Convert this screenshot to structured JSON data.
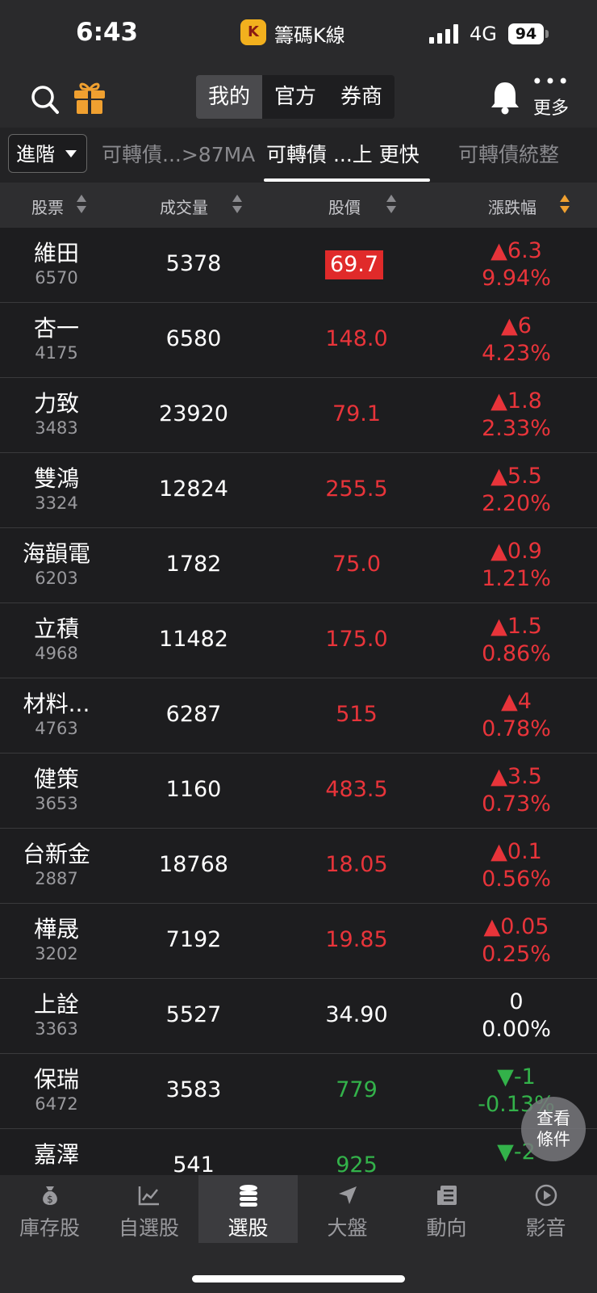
{
  "status": {
    "time": "6:43",
    "app_icon": "K",
    "app_name": "籌碼K線",
    "network": "4G",
    "battery": "94"
  },
  "header": {
    "segments": [
      "我的",
      "官方",
      "券商"
    ],
    "more_label": "更多"
  },
  "subtabs": {
    "advanced": "進階",
    "tabs": [
      "可轉債...>87MA",
      "可轉債 ...上 更快",
      "可轉債統整"
    ]
  },
  "table": {
    "headers": {
      "stock": "股票",
      "volume": "成交量",
      "price": "股價",
      "change": "漲跌幅"
    },
    "rows": [
      {
        "name": "維田",
        "code": "6570",
        "volume": "5378",
        "price": "69.7",
        "change": "▲6.3",
        "pct": "9.94%",
        "dir": "up",
        "limit_up": true
      },
      {
        "name": "杏一",
        "code": "4175",
        "volume": "6580",
        "price": "148.0",
        "change": "▲6",
        "pct": "4.23%",
        "dir": "up"
      },
      {
        "name": "力致",
        "code": "3483",
        "volume": "23920",
        "price": "79.1",
        "change": "▲1.8",
        "pct": "2.33%",
        "dir": "up"
      },
      {
        "name": "雙鴻",
        "code": "3324",
        "volume": "12824",
        "price": "255.5",
        "change": "▲5.5",
        "pct": "2.20%",
        "dir": "up"
      },
      {
        "name": "海韻電",
        "code": "6203",
        "volume": "1782",
        "price": "75.0",
        "change": "▲0.9",
        "pct": "1.21%",
        "dir": "up"
      },
      {
        "name": "立積",
        "code": "4968",
        "volume": "11482",
        "price": "175.0",
        "change": "▲1.5",
        "pct": "0.86%",
        "dir": "up"
      },
      {
        "name": "材料...",
        "code": "4763",
        "volume": "6287",
        "price": "515",
        "change": "▲4",
        "pct": "0.78%",
        "dir": "up"
      },
      {
        "name": "健策",
        "code": "3653",
        "volume": "1160",
        "price": "483.5",
        "change": "▲3.5",
        "pct": "0.73%",
        "dir": "up"
      },
      {
        "name": "台新金",
        "code": "2887",
        "volume": "18768",
        "price": "18.05",
        "change": "▲0.1",
        "pct": "0.56%",
        "dir": "up"
      },
      {
        "name": "樺晟",
        "code": "3202",
        "volume": "7192",
        "price": "19.85",
        "change": "▲0.05",
        "pct": "0.25%",
        "dir": "up"
      },
      {
        "name": "上詮",
        "code": "3363",
        "volume": "5527",
        "price": "34.90",
        "change": "0",
        "pct": "0.00%",
        "dir": "flat"
      },
      {
        "name": "保瑞",
        "code": "6472",
        "volume": "3583",
        "price": "779",
        "change": "▼-1",
        "pct": "-0.13%",
        "dir": "down"
      },
      {
        "name": "嘉澤",
        "code": "",
        "volume": "541",
        "price": "925",
        "change": "▼-2",
        "pct": "",
        "dir": "down"
      }
    ]
  },
  "fab": {
    "line1": "查看",
    "line2": "條件"
  },
  "tabbar": [
    {
      "label": "庫存股",
      "icon": "moneybag-icon"
    },
    {
      "label": "自選股",
      "icon": "chart-line-icon"
    },
    {
      "label": "選股",
      "icon": "coin-stack-icon",
      "active": true
    },
    {
      "label": "大盤",
      "icon": "navigation-arrow-icon"
    },
    {
      "label": "動向",
      "icon": "newspaper-icon"
    },
    {
      "label": "影音",
      "icon": "play-circle-icon"
    }
  ],
  "colors": {
    "up": "#e8343a",
    "down": "#33b24a",
    "accent": "#f0a030"
  }
}
